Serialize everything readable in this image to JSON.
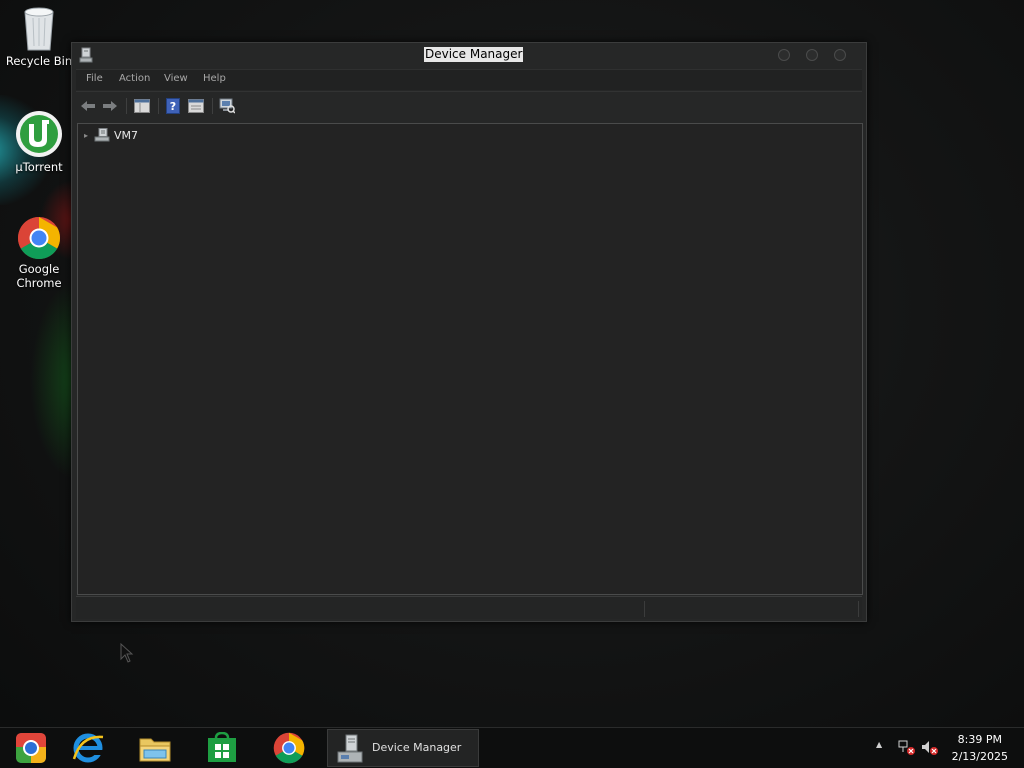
{
  "desktop": {
    "icons": [
      {
        "label": "Recycle Bin"
      },
      {
        "label": "µTorrent"
      },
      {
        "label_line1": "Google",
        "label_line2": "Chrome"
      }
    ]
  },
  "window": {
    "title": "Device Manager",
    "menu": [
      "File",
      "Action",
      "View",
      "Help"
    ],
    "tree_root": "VM7"
  },
  "taskbar": {
    "active_window_label": "Device Manager",
    "clock_time": "8:39 PM",
    "clock_date": "2/13/2025",
    "tray_overflow": "▲"
  }
}
